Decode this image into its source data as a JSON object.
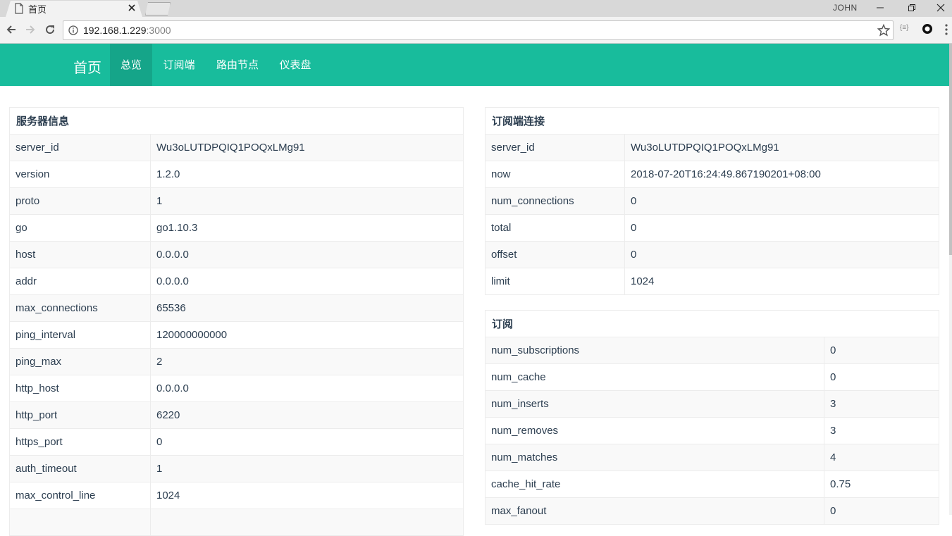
{
  "browser": {
    "tab_title": "首页",
    "profile_name": "JOHN",
    "url_host": "192.168.1.229",
    "url_port": ":3000"
  },
  "navbar": {
    "brand": "首页",
    "items": [
      {
        "label": "总览",
        "active": true
      },
      {
        "label": "订阅端",
        "active": false
      },
      {
        "label": "路由节点",
        "active": false
      },
      {
        "label": "仪表盘",
        "active": false
      }
    ],
    "color": "#18bc9c"
  },
  "server_info": {
    "title": "服务器信息",
    "rows": [
      {
        "key": "server_id",
        "value": "Wu3oLUTDPQIQ1POQxLMg91"
      },
      {
        "key": "version",
        "value": "1.2.0"
      },
      {
        "key": "proto",
        "value": "1"
      },
      {
        "key": "go",
        "value": "go1.10.3"
      },
      {
        "key": "host",
        "value": "0.0.0.0"
      },
      {
        "key": "addr",
        "value": "0.0.0.0"
      },
      {
        "key": "max_connections",
        "value": "65536"
      },
      {
        "key": "ping_interval",
        "value": "120000000000"
      },
      {
        "key": "ping_max",
        "value": "2"
      },
      {
        "key": "http_host",
        "value": "0.0.0.0"
      },
      {
        "key": "http_port",
        "value": "6220"
      },
      {
        "key": "https_port",
        "value": "0"
      },
      {
        "key": "auth_timeout",
        "value": "1"
      },
      {
        "key": "max_control_line",
        "value": "1024"
      },
      {
        "key": "",
        "value": ""
      }
    ]
  },
  "connections": {
    "title": "订阅端连接",
    "rows": [
      {
        "key": "server_id",
        "value": "Wu3oLUTDPQIQ1POQxLMg91"
      },
      {
        "key": "now",
        "value": "2018-07-20T16:24:49.867190201+08:00"
      },
      {
        "key": "num_connections",
        "value": "0"
      },
      {
        "key": "total",
        "value": "0"
      },
      {
        "key": "offset",
        "value": "0"
      },
      {
        "key": "limit",
        "value": "1024"
      }
    ]
  },
  "subscriptions": {
    "title": "订阅",
    "rows": [
      {
        "key": "num_subscriptions",
        "value": "0"
      },
      {
        "key": "num_cache",
        "value": "0"
      },
      {
        "key": "num_inserts",
        "value": "3"
      },
      {
        "key": "num_removes",
        "value": "3"
      },
      {
        "key": "num_matches",
        "value": "4"
      },
      {
        "key": "cache_hit_rate",
        "value": "0.75"
      },
      {
        "key": "max_fanout",
        "value": "0"
      }
    ]
  }
}
